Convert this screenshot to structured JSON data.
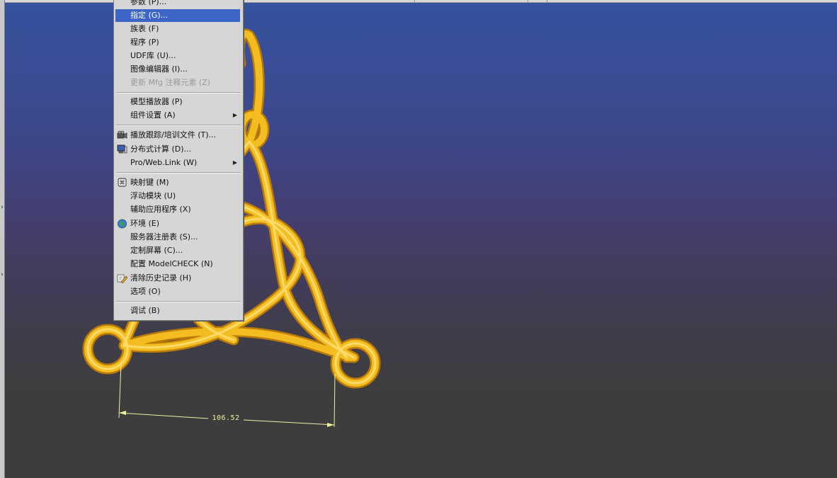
{
  "menu": {
    "items": [
      {
        "label": "参数 (P)...",
        "state": "normal"
      },
      {
        "label": "指定 (G)...",
        "state": "active"
      },
      {
        "label": "族表 (F)",
        "state": "normal"
      },
      {
        "label": "程序 (P)",
        "state": "normal"
      },
      {
        "label": "UDF库 (U)...",
        "state": "normal"
      },
      {
        "label": "图像编辑器 (I)...",
        "state": "normal"
      },
      {
        "label": "更新 Mfg 注释元素 (Z)",
        "state": "disabled"
      },
      {
        "label": "模型播放器 (P)",
        "state": "normal"
      },
      {
        "label": "组件设置 (A)",
        "state": "normal",
        "submenu": true
      },
      {
        "label": "播放跟踪/培训文件 (T)...",
        "state": "normal",
        "icon": "camera-icon"
      },
      {
        "label": "分布式计算 (D)...",
        "state": "normal",
        "icon": "computer-icon"
      },
      {
        "label": "Pro/Web.Link (W)",
        "state": "normal",
        "submenu": true
      },
      {
        "label": "映射键 (M)",
        "state": "normal",
        "icon": "mapkey-icon"
      },
      {
        "label": "浮动模块 (U)",
        "state": "normal"
      },
      {
        "label": "辅助应用程序 (X)",
        "state": "normal"
      },
      {
        "label": "环境 (E)",
        "state": "normal",
        "icon": "globe-icon"
      },
      {
        "label": "服务器注册表 (S)...",
        "state": "normal"
      },
      {
        "label": "定制屏幕 (C)...",
        "state": "normal"
      },
      {
        "label": "配置 ModelCHECK (N)",
        "state": "normal"
      },
      {
        "label": "清除历史记录 (H)",
        "state": "normal",
        "icon": "eraser-icon"
      },
      {
        "label": "选项 (O)",
        "state": "normal"
      },
      {
        "label": "调试 (B)",
        "state": "normal"
      }
    ]
  },
  "model": {
    "dimension_value": "106.52",
    "tube_color": "#f0b81e",
    "dimension_color": "#f1f0a0"
  },
  "colors": {
    "viewport_top": "#34529e",
    "viewport_bottom": "#3d3d3d",
    "menu_bg": "#d6d6d6",
    "menu_highlight": "#3c65c7"
  }
}
